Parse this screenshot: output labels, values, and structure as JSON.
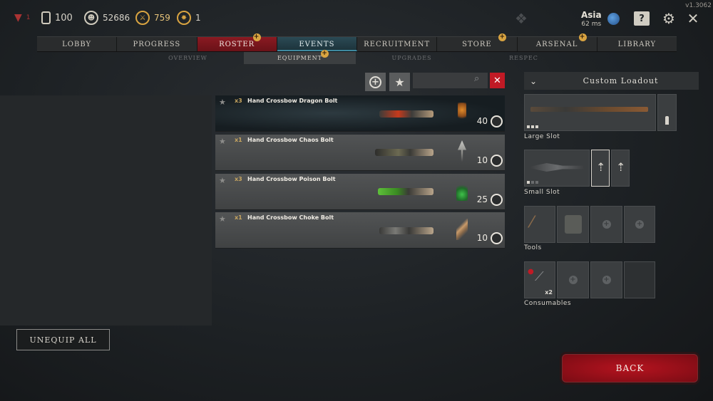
{
  "version": "v1.3062",
  "top_stats": {
    "alert_count": "1",
    "tokens": "100",
    "currency": "52686",
    "skill_points": "759",
    "prestige": "1"
  },
  "region": {
    "name": "Asia",
    "ping": "62 ms"
  },
  "nav": {
    "tabs": [
      "LOBBY",
      "PROGRESS",
      "ROSTER",
      "EVENTS",
      "RECRUITMENT",
      "STORE",
      "ARSENAL",
      "LIBRARY"
    ]
  },
  "subnav": {
    "tabs": [
      "OVERVIEW",
      "EQUIPMENT",
      "UPGRADES",
      "RESPEC"
    ]
  },
  "search": {
    "placeholder": ""
  },
  "items": [
    {
      "qty": "x3",
      "name": "Hand Crossbow Dragon Bolt",
      "cost": "40"
    },
    {
      "qty": "x1",
      "name": "Hand Crossbow Chaos Bolt",
      "cost": "10"
    },
    {
      "qty": "x3",
      "name": "Hand Crossbow Poison Bolt",
      "cost": "25"
    },
    {
      "qty": "x1",
      "name": "Hand Crossbow Choke Bolt",
      "cost": "10"
    }
  ],
  "loadout": {
    "title": "Custom Loadout",
    "large_slot_label": "Large Slot",
    "small_slot_label": "Small Slot",
    "tools_label": "Tools",
    "consumables_label": "Consumables",
    "consumable_count": "x2"
  },
  "buttons": {
    "unequip_all": "UNEQUIP ALL",
    "back": "BACK"
  },
  "colors": {
    "accent_red": "#c11a25",
    "gold": "#d9a441",
    "events_blue": "#3f8aa0"
  }
}
